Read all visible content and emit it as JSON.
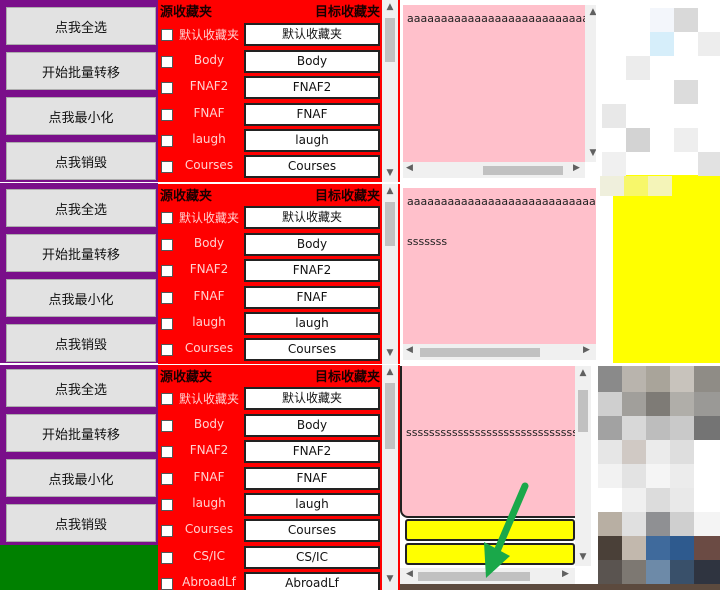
{
  "buttons": {
    "select_all": "点我全选",
    "batch_transfer": "开始批量转移",
    "minimize": "点我最小化",
    "destroy": "点我销毁"
  },
  "table": {
    "source_header": "源收藏夹",
    "target_header": "目标收藏夹",
    "rows": [
      {
        "source": "默认收藏夹",
        "target": "默认收藏夹"
      },
      {
        "source": "Body",
        "target": "Body"
      },
      {
        "source": "FNAF2",
        "target": "FNAF2"
      },
      {
        "source": "FNAF",
        "target": "FNAF"
      },
      {
        "source": "laugh",
        "target": "laugh"
      },
      {
        "source": "Courses",
        "target": "Courses"
      },
      {
        "source": "CS/IC",
        "target": "CS/IC"
      },
      {
        "source": "AbroadLf",
        "target": "AbroadLf"
      }
    ]
  },
  "text_boxes": {
    "box1_line1": "aaaaaaaaaaaaaaaaaaaaaaaaaaaaa",
    "box2_line1": "aaaaaaaaaaaaaaaaaaaaaaaaaaaaaaaaaa",
    "box2_line2": "sssssss",
    "box3_line1": "ssssssssssssssssssssssssssssssssss"
  },
  "colors": {
    "purple": "#7a0f8a",
    "red": "#ff0000",
    "pink": "#ffc0cb",
    "yellow": "#ffff00",
    "green": "#008000",
    "arrow": "#1aa84a"
  }
}
